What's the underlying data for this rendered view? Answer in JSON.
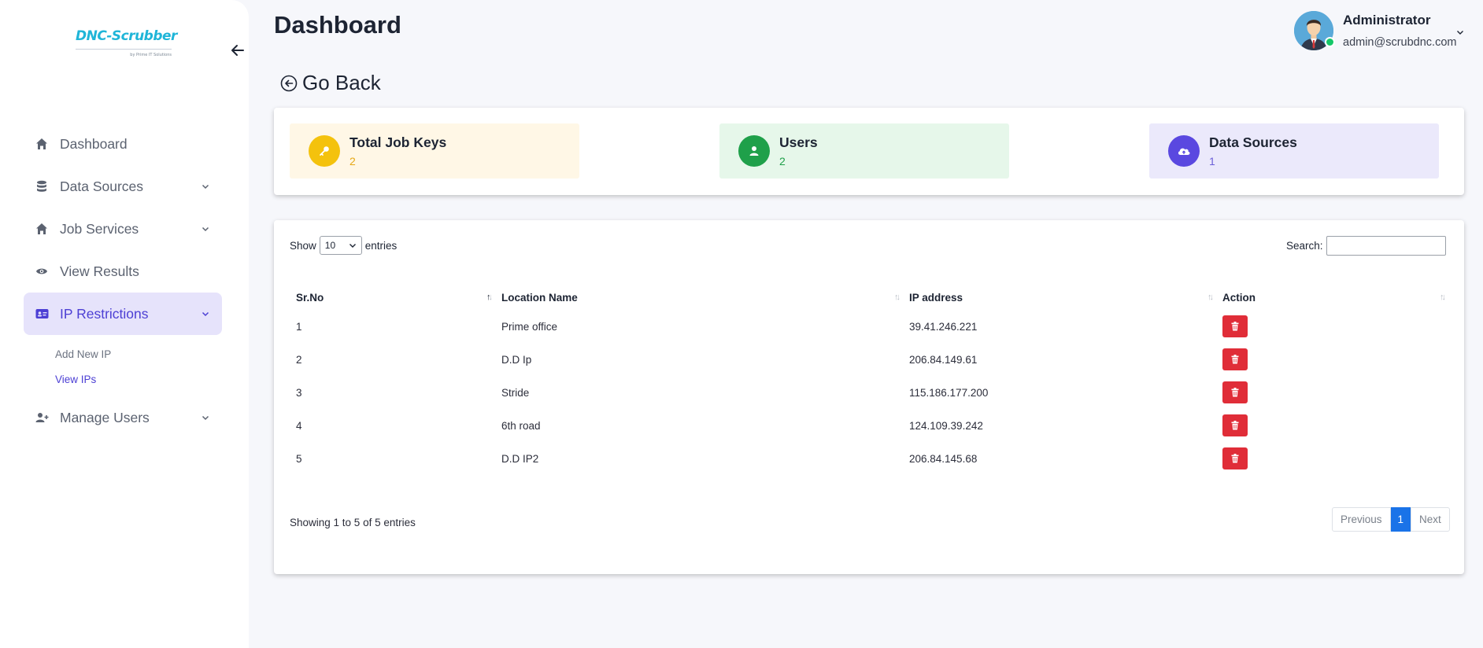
{
  "logo": {
    "name": "DNC-Scrubber",
    "tagline": "by Prime IT Solutions"
  },
  "sidebar": {
    "items": [
      {
        "label": "Dashboard",
        "icon": "home-icon"
      },
      {
        "label": "Data Sources",
        "icon": "database-icon",
        "expandable": true
      },
      {
        "label": "Job Services",
        "icon": "home-icon",
        "expandable": true
      },
      {
        "label": "View Results",
        "icon": "eye-icon"
      },
      {
        "label": "IP Restrictions",
        "icon": "id-card-icon",
        "expandable": true,
        "active": true,
        "subitems": [
          {
            "label": "Add New IP"
          },
          {
            "label": "View IPs",
            "active": true
          }
        ]
      },
      {
        "label": "Manage Users",
        "icon": "user-plus-icon",
        "expandable": true
      }
    ]
  },
  "header": {
    "title": "Dashboard",
    "user": {
      "name": "Administrator",
      "email": "admin@scrubdnc.com",
      "status_color": "#14c768"
    }
  },
  "go_back": {
    "label": "Go Back"
  },
  "stats": [
    {
      "title": "Total Job Keys",
      "value": "2",
      "bg": "#fff7e6",
      "icon_color": "#f4c20d",
      "value_color": "#e6a817",
      "icon": "key-icon"
    },
    {
      "title": "Users",
      "value": "2",
      "bg": "#e6f7ea",
      "icon_color": "#1fa04a",
      "value_color": "#1fa04a",
      "icon": "user-icon"
    },
    {
      "title": "Data Sources",
      "value": "1",
      "bg": "#ebe9fb",
      "icon_color": "#5a48e0",
      "value_color": "#6b5fd8",
      "icon": "cloud-upload-icon"
    }
  ],
  "table": {
    "show_label": "Show",
    "entries_label": "entries",
    "page_length": "10",
    "search_label": "Search:",
    "search_value": "",
    "columns": [
      "Sr.No",
      "Location Name",
      "IP address",
      "Action"
    ],
    "rows": [
      {
        "sr": "1",
        "location": "Prime office",
        "ip": "39.41.246.221"
      },
      {
        "sr": "2",
        "location": "D.D Ip",
        "ip": "206.84.149.61"
      },
      {
        "sr": "3",
        "location": "Stride",
        "ip": "115.186.177.200"
      },
      {
        "sr": "4",
        "location": "6th road",
        "ip": "124.109.39.242"
      },
      {
        "sr": "5",
        "location": "D.D IP2",
        "ip": "206.84.145.68"
      }
    ],
    "info": "Showing 1 to 5 of 5 entries",
    "pagination": {
      "previous": "Previous",
      "current": "1",
      "next": "Next"
    }
  },
  "colors": {
    "accent": "#4c3fd4",
    "danger": "#e02d38",
    "primary": "#1a73e8"
  }
}
